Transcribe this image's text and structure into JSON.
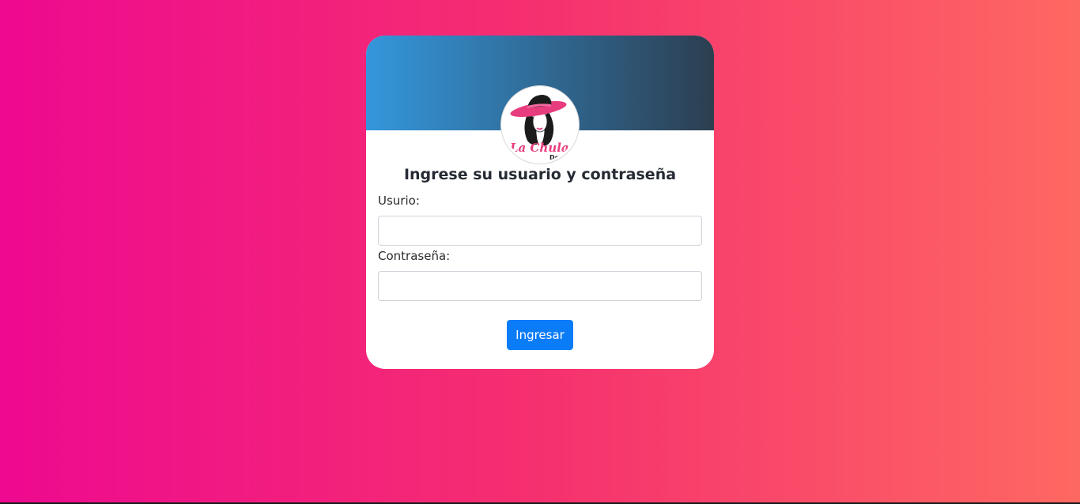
{
  "login": {
    "heading": "Ingrese su usuario y contraseña",
    "username_label": "Usurio:",
    "username_value": "",
    "password_label": "Contraseña:",
    "password_value": "",
    "submit_label": "Ingresar"
  },
  "logo": {
    "icon": "woman-with-pink-hat-logo",
    "text": "La Chula",
    "subtext": "De S"
  },
  "colors": {
    "background_start": "#ee0990",
    "background_end": "#fe6862",
    "header_start": "#3497dc",
    "header_end": "#2c3e50",
    "button": "#0a7cf8"
  }
}
